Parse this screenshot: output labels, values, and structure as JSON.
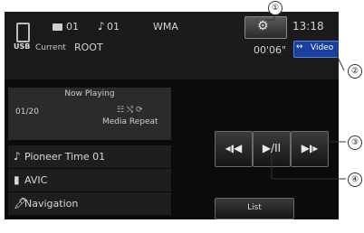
{
  "header": {
    "usb_label": "USB",
    "folder_number": "01",
    "note_symbol": "♪",
    "track_number": "01",
    "format": "WMA",
    "current_label": "Current",
    "folder_name": "ROOT",
    "clock": "13:18",
    "elapsed_time": "00'06\"",
    "video_button": {
      "arrow": "↔",
      "label": "Video"
    }
  },
  "now_playing": {
    "title": "Now Playing",
    "track_count": "01/20",
    "mode_icons": "☷ ⤭ ⟳",
    "mode_text": "Media Repeat"
  },
  "info_rows": [
    {
      "icon": "music-note-icon",
      "glyph": "♪",
      "text": "Pioneer Time 01"
    },
    {
      "icon": "artist-icon",
      "glyph": "▮",
      "text": "AVIC"
    },
    {
      "icon": "album-icon",
      "glyph": "🖊",
      "text": "Navigation"
    }
  ],
  "controls": {
    "prev": "◀◀",
    "play_pause": "▶/II",
    "next": "▶▶",
    "list": "List"
  },
  "callouts": [
    "①",
    "②",
    "③",
    "④"
  ],
  "colors": {
    "background": "#0b0b0b",
    "accent": "#1a3fa0"
  }
}
